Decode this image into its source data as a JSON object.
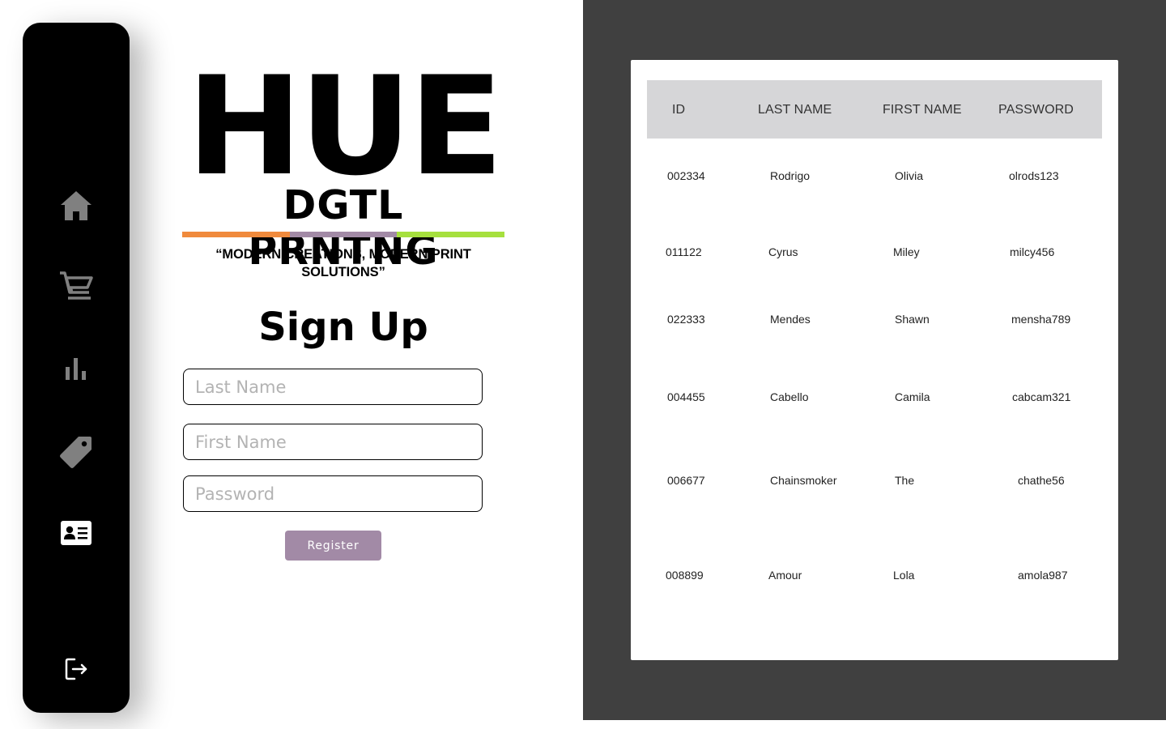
{
  "sidebar": {
    "items": [
      {
        "name": "home-icon"
      },
      {
        "name": "cart-icon"
      },
      {
        "name": "bar-chart-icon"
      },
      {
        "name": "tag-icon"
      },
      {
        "name": "id-card-icon",
        "active": true
      },
      {
        "name": "logout-icon"
      }
    ],
    "colors": {
      "background": "#000000",
      "icon": "#808080",
      "active_icon": "#ffffff"
    }
  },
  "brand": {
    "title": "HUE",
    "subtitle": "DGTL PRNTNG",
    "tagline": "“MODERN CREATIONS, MODERN PRINT SOLUTIONS”",
    "bar_colors": [
      "#f08a3c",
      "#a28aa6",
      "#a6e03e"
    ]
  },
  "form": {
    "title": "Sign Up",
    "last_name": {
      "placeholder": "Last Name",
      "value": ""
    },
    "first_name": {
      "placeholder": "First Name",
      "value": ""
    },
    "password": {
      "placeholder": "Password",
      "value": ""
    },
    "register_label": "Register",
    "accent": "#a28aa6"
  },
  "table": {
    "columns": [
      "ID",
      "LAST NAME",
      "FIRST NAME",
      "PASSWORD"
    ],
    "rows": [
      [
        "002334",
        "Rodrigo",
        "Olivia",
        "olrods123"
      ],
      [
        "011122",
        "Cyrus",
        "Miley",
        "milcy456"
      ],
      [
        "022333",
        "Mendes",
        "Shawn",
        "mensha789"
      ],
      [
        "004455",
        "Cabello",
        "Camila",
        "cabcam321"
      ],
      [
        "006677",
        "Chainsmoker",
        "The",
        "chathe56"
      ],
      [
        "008899",
        "Amour",
        "Lola",
        "amola987"
      ]
    ],
    "colors": {
      "panel": "#404040",
      "header": "#d6d6d8"
    }
  }
}
